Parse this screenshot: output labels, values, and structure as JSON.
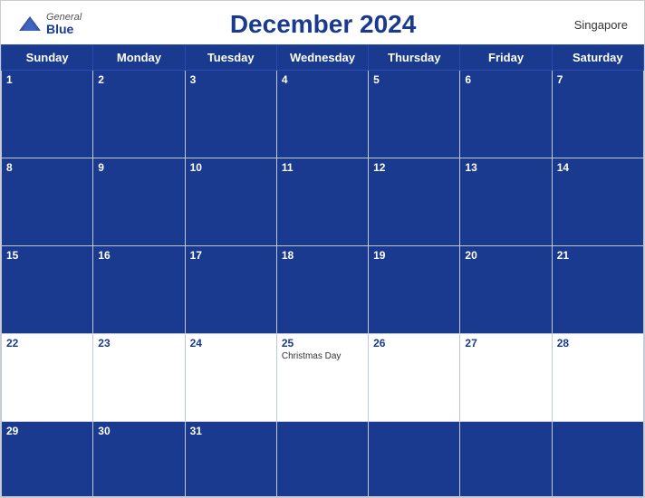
{
  "header": {
    "logo_general": "General",
    "logo_blue": "Blue",
    "title": "December 2024",
    "region": "Singapore"
  },
  "weekdays": [
    "Sunday",
    "Monday",
    "Tuesday",
    "Wednesday",
    "Thursday",
    "Friday",
    "Saturday"
  ],
  "weeks": [
    [
      {
        "day": "1",
        "bg": "blue",
        "event": ""
      },
      {
        "day": "2",
        "bg": "blue",
        "event": ""
      },
      {
        "day": "3",
        "bg": "blue",
        "event": ""
      },
      {
        "day": "4",
        "bg": "blue",
        "event": ""
      },
      {
        "day": "5",
        "bg": "blue",
        "event": ""
      },
      {
        "day": "6",
        "bg": "blue",
        "event": ""
      },
      {
        "day": "7",
        "bg": "blue",
        "event": ""
      }
    ],
    [
      {
        "day": "8",
        "bg": "blue",
        "event": ""
      },
      {
        "day": "9",
        "bg": "blue",
        "event": ""
      },
      {
        "day": "10",
        "bg": "blue",
        "event": ""
      },
      {
        "day": "11",
        "bg": "blue",
        "event": ""
      },
      {
        "day": "12",
        "bg": "blue",
        "event": ""
      },
      {
        "day": "13",
        "bg": "blue",
        "event": ""
      },
      {
        "day": "14",
        "bg": "blue",
        "event": ""
      }
    ],
    [
      {
        "day": "15",
        "bg": "blue",
        "event": ""
      },
      {
        "day": "16",
        "bg": "blue",
        "event": ""
      },
      {
        "day": "17",
        "bg": "blue",
        "event": ""
      },
      {
        "day": "18",
        "bg": "blue",
        "event": ""
      },
      {
        "day": "19",
        "bg": "blue",
        "event": ""
      },
      {
        "day": "20",
        "bg": "blue",
        "event": ""
      },
      {
        "day": "21",
        "bg": "blue",
        "event": ""
      }
    ],
    [
      {
        "day": "22",
        "bg": "white",
        "event": ""
      },
      {
        "day": "23",
        "bg": "white",
        "event": ""
      },
      {
        "day": "24",
        "bg": "white",
        "event": ""
      },
      {
        "day": "25",
        "bg": "white",
        "event": "Christmas Day"
      },
      {
        "day": "26",
        "bg": "white",
        "event": ""
      },
      {
        "day": "27",
        "bg": "white",
        "event": ""
      },
      {
        "day": "28",
        "bg": "white",
        "event": ""
      }
    ],
    [
      {
        "day": "29",
        "bg": "blue",
        "event": ""
      },
      {
        "day": "30",
        "bg": "blue",
        "event": ""
      },
      {
        "day": "31",
        "bg": "blue",
        "event": ""
      },
      {
        "day": "",
        "bg": "blue",
        "event": ""
      },
      {
        "day": "",
        "bg": "blue",
        "event": ""
      },
      {
        "day": "",
        "bg": "blue",
        "event": ""
      },
      {
        "day": "",
        "bg": "blue",
        "event": ""
      }
    ]
  ]
}
